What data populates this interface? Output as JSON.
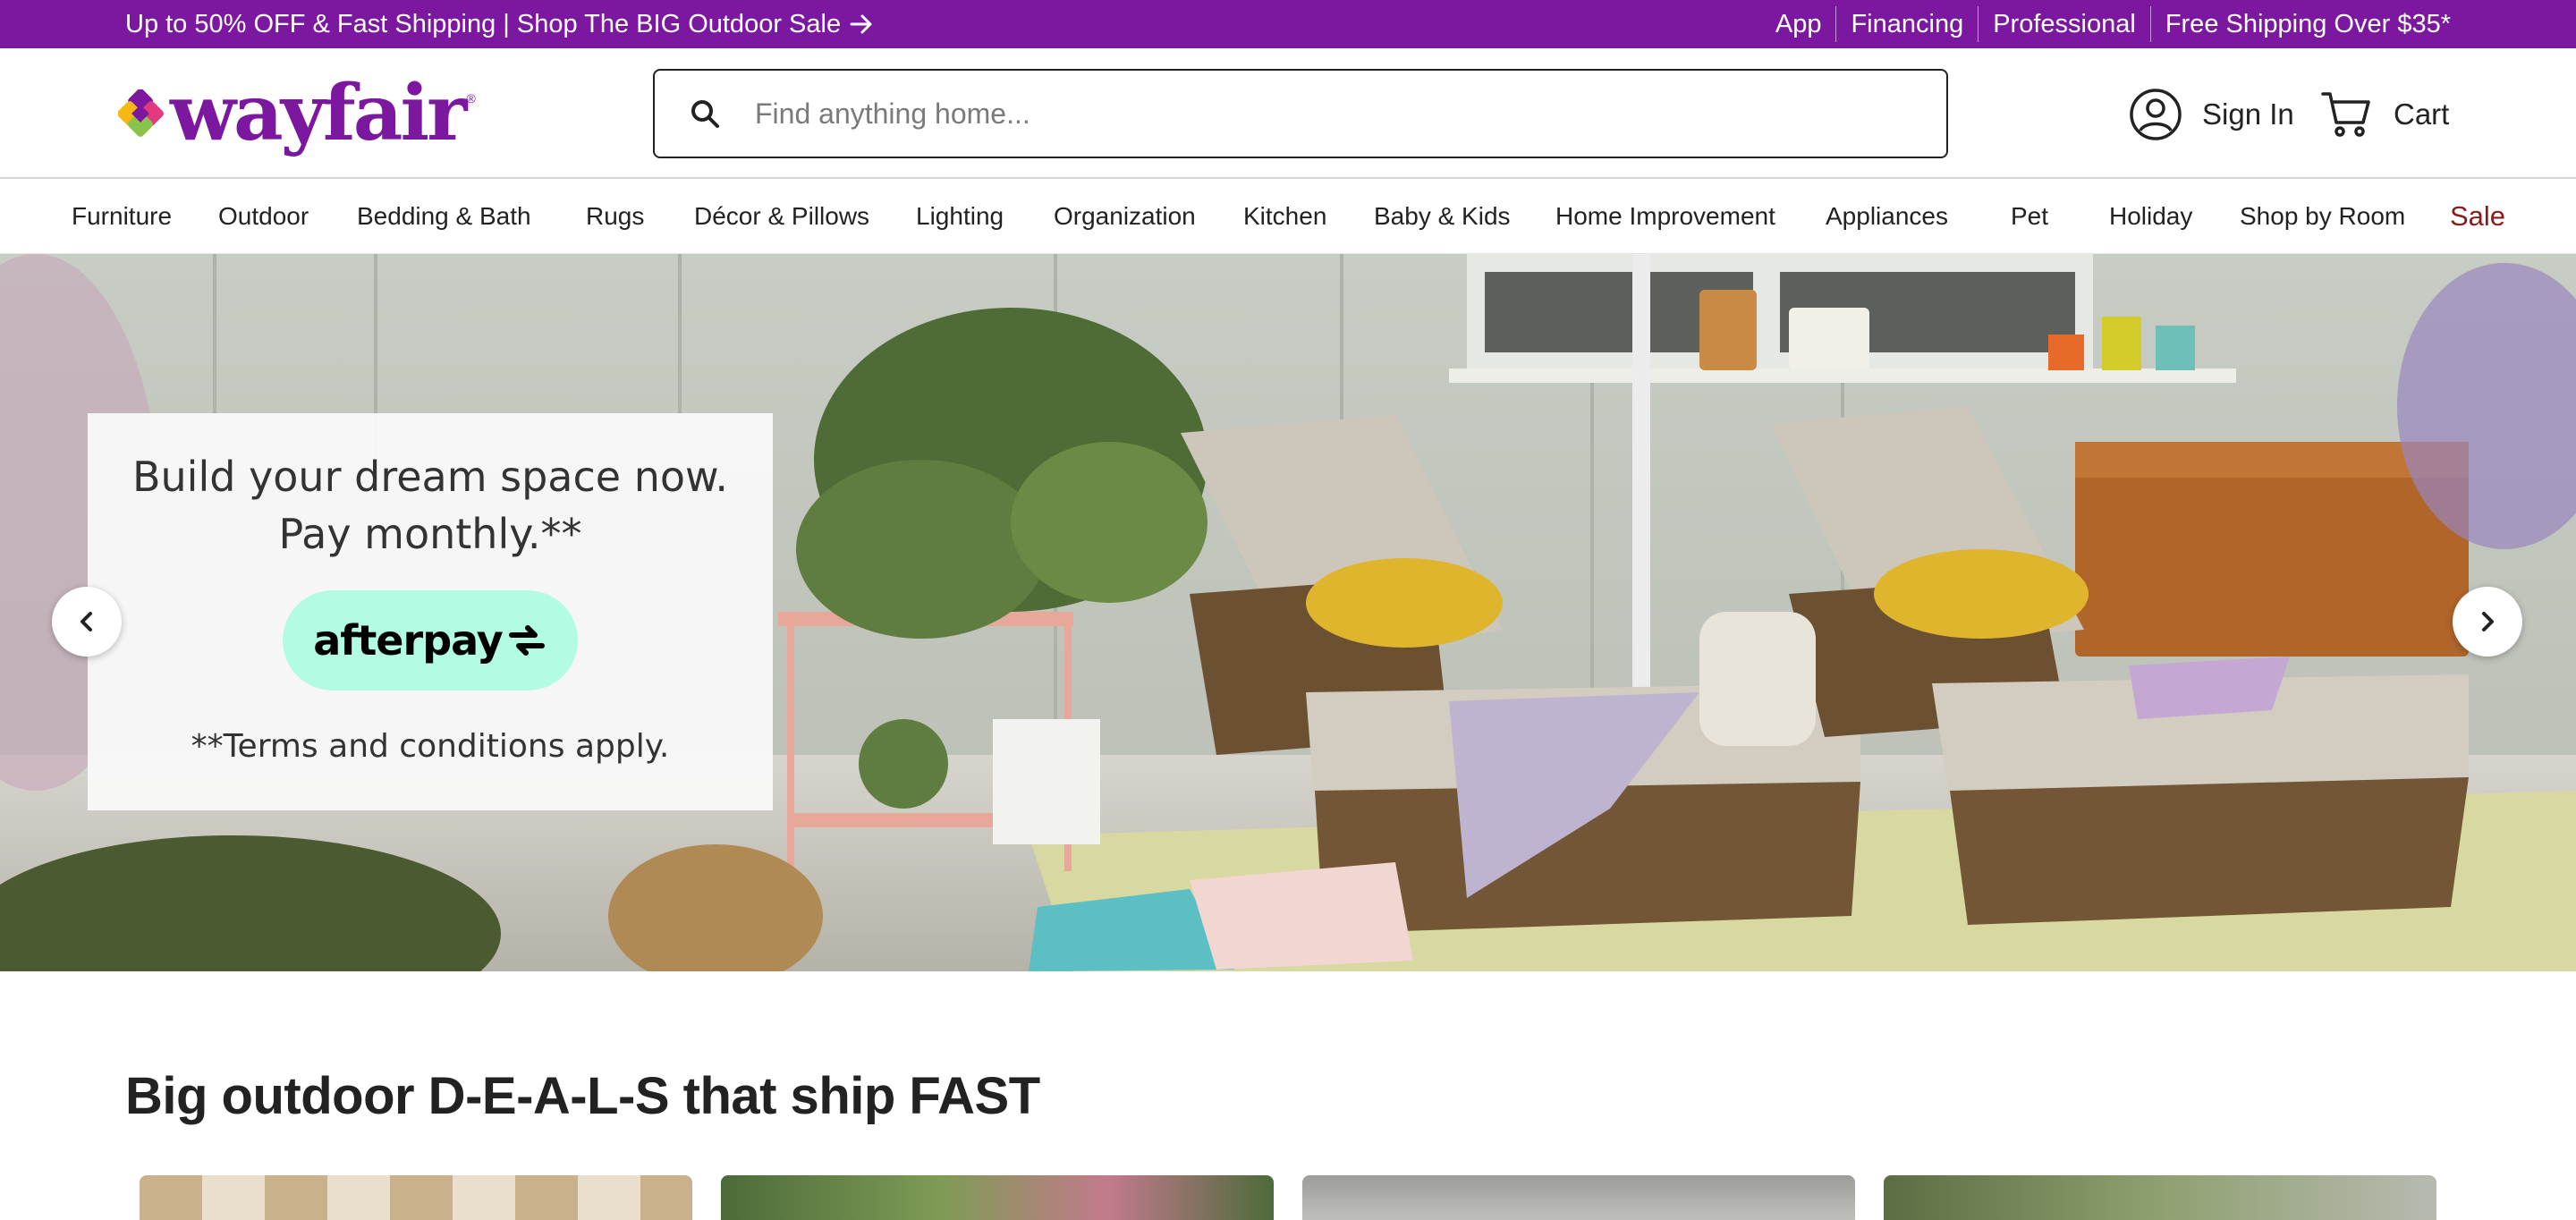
{
  "promo_bar": {
    "message": "Up to 50% OFF & Fast Shipping | Shop The BIG Outdoor Sale",
    "links": [
      "App",
      "Financing",
      "Professional",
      "Free Shipping Over $35*"
    ],
    "background": "#7b189f"
  },
  "header": {
    "logo_text": "wayfair",
    "search": {
      "placeholder": "Find anything home...",
      "value": ""
    },
    "sign_in_label": "Sign In",
    "cart_label": "Cart"
  },
  "nav": {
    "items": [
      "Furniture",
      "Outdoor",
      "Bedding & Bath",
      "Rugs",
      "Décor & Pillows",
      "Lighting",
      "Organization",
      "Kitchen",
      "Baby & Kids",
      "Home Improvement",
      "Appliances",
      "Pet",
      "Holiday",
      "Shop by Room"
    ],
    "sale_label": "Sale",
    "sale_color": "#8b1a1a"
  },
  "hero": {
    "line1": "Build your dream space now.",
    "line2": "Pay monthly.**",
    "brand": "afterpay",
    "brand_color": "#b2fce4",
    "terms": "**Terms and conditions apply.",
    "prev_icon": "chevron-left-icon",
    "next_icon": "chevron-right-icon"
  },
  "section": {
    "title": "Big outdoor D-E-A-L-S that ship FAST"
  },
  "icons": {
    "search": "search-icon",
    "account": "account-circle-icon",
    "cart": "cart-icon",
    "promo_arrow": "arrow-right-icon"
  }
}
